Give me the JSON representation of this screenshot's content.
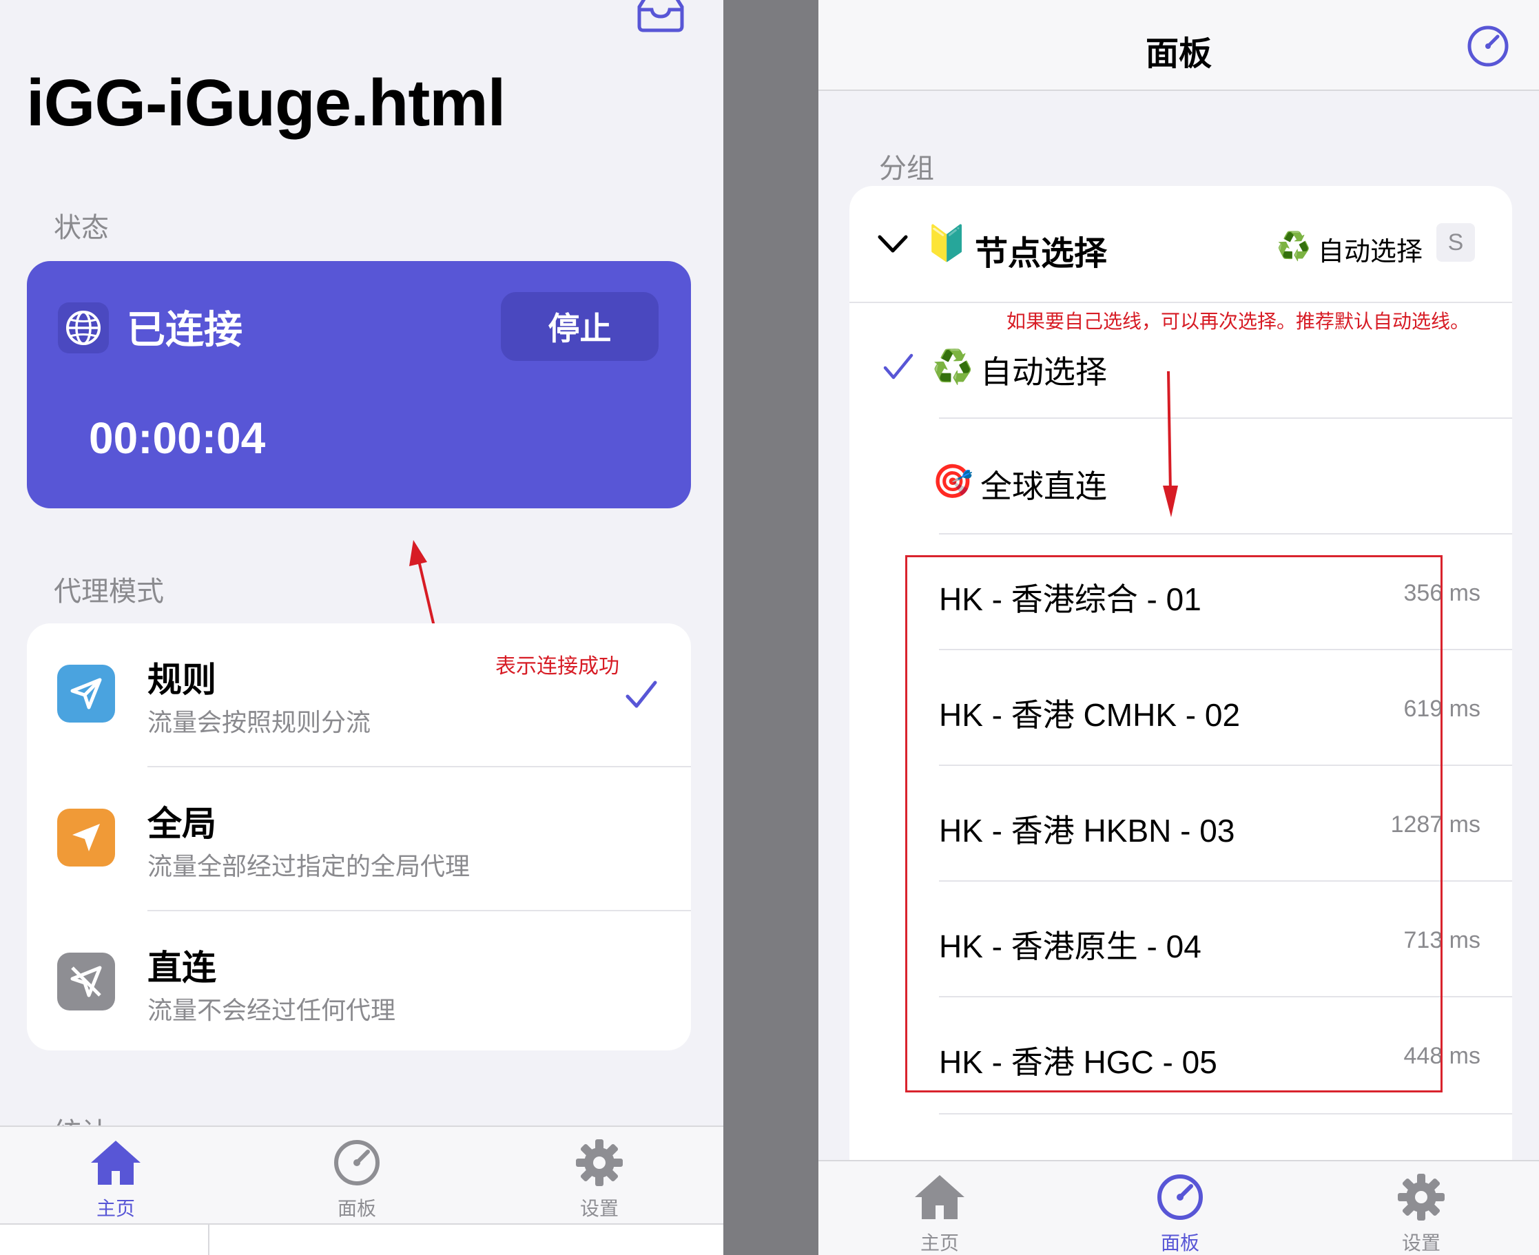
{
  "left": {
    "page_title": "iGG-iGuge.html",
    "status_section_label": "状态",
    "status": {
      "text": "已连接",
      "stop_label": "停止",
      "timer": "00:00:04",
      "accent": "#5856d6"
    },
    "mode_section_label": "代理模式",
    "modes": [
      {
        "title": "规则",
        "subtitle": "流量会按照规则分流",
        "icon": "paper-plane-icon",
        "color": "#4aa3df",
        "selected": true
      },
      {
        "title": "全局",
        "subtitle": "流量全部经过指定的全局代理",
        "icon": "location-arrow-icon",
        "color": "#f09a37",
        "selected": false
      },
      {
        "title": "直连",
        "subtitle": "流量不会经过任何代理",
        "icon": "direct-off-icon",
        "color": "#8e8e93",
        "selected": false
      }
    ],
    "stats_section_label_partial": "统计",
    "annotation": "表示连接成功",
    "tabbar": {
      "tabs": [
        "主页",
        "面板",
        "设置"
      ],
      "active": 0
    }
  },
  "right": {
    "header_title": "面板",
    "group_section_label": "分组",
    "group": {
      "name": "节点选择",
      "name_emoji": "🔰",
      "current_emoji": "♻️",
      "current": "自动选择",
      "badge": "S"
    },
    "annotation": "如果要自己选线，可以再次选择。推荐默认自动选线。",
    "options": [
      {
        "emoji": "♻️",
        "name": "自动选择",
        "selected": true
      },
      {
        "emoji": "🎯",
        "name": "全球直连",
        "selected": false
      }
    ],
    "nodes": [
      {
        "name": "HK - 香港综合 - 01",
        "latency": "356 ms"
      },
      {
        "name": "HK - 香港 CMHK - 02",
        "latency": "619 ms"
      },
      {
        "name": "HK - 香港 HKBN - 03",
        "latency": "1287 ms"
      },
      {
        "name": "HK - 香港原生 - 04",
        "latency": "713 ms"
      },
      {
        "name": "HK - 香港 HGC - 05",
        "latency": "448 ms"
      }
    ],
    "tabbar": {
      "tabs": [
        "主页",
        "面板",
        "设置"
      ],
      "active": 1
    }
  },
  "colors": {
    "accent": "#5856d6",
    "annotation_red": "#d71c25",
    "secondary_text": "#8a8a8e"
  }
}
